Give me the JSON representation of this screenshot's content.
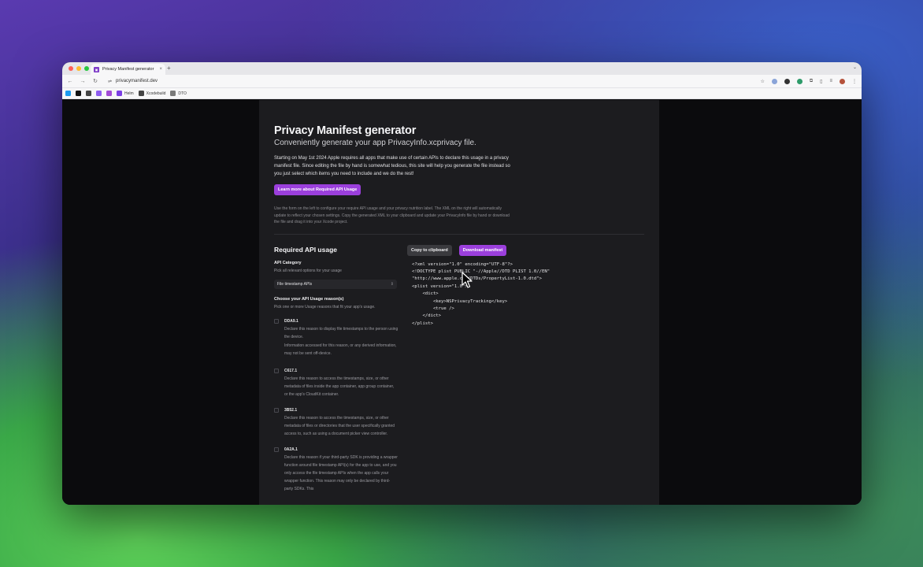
{
  "browser": {
    "tab_title": "Privacy Manifest generator",
    "tab_close": "×",
    "new_tab": "+",
    "tab_menu": "⌄",
    "url": "privacymanifest.dev",
    "bookmarks": [
      {
        "label": "",
        "color": "#1d9bf0"
      },
      {
        "label": "",
        "color": "#111111"
      },
      {
        "label": "",
        "color": "#444444"
      },
      {
        "label": "",
        "color": "#8e5cf0"
      },
      {
        "label": "",
        "color": "#a24bd6"
      },
      {
        "label": "Helm",
        "color": "#7b3fe4"
      },
      {
        "label": "Xcodebuild",
        "color": "#444444"
      },
      {
        "label": "DTO",
        "color": "#7a7a7a"
      }
    ]
  },
  "page": {
    "title": "Privacy Manifest generator",
    "subtitle": "Conveniently generate your app PrivacyInfo.xcprivacy file.",
    "intro": "Starting on May 1st 2024 Apple requires all apps that make use of certain APIs to declare this usage in a privacy manifest file. Since editing the file by hand is somewhat tedious, this site will help you generate the file instead so you just select which items you need to include and we do the rest!",
    "learn_more_button": "Learn more about Required API Usage",
    "howto": "Use the form on the left to configure your require API usage and your privacy nutrition label. The XML on the right will automatically update to reflect your chosen settings. Copy the generated XML to your clipboard and update your PrivacyInfo file by hand or download the file and drag it into your Xcode project.",
    "section_title": "Required API usage",
    "api_category_label": "API Category",
    "api_category_help": "Pick all relevant options for your usage",
    "api_category_value": "File timestamp APIs",
    "reasons_label": "Choose your API Usage reason(s)",
    "reasons_help": "Pick one or more Usage reasons that fit your app's usage.",
    "reasons": [
      {
        "code": "DDA9.1",
        "desc": "Declare this reason to display file timestamps to the person using the device.",
        "note": "Information accessed for this reason, or any derived information, may not be sent off-device."
      },
      {
        "code": "C617.1",
        "desc": "Declare this reason to access the timestamps, size, or other metadata of files inside the app container, app group container, or the app's CloudKit container.",
        "note": ""
      },
      {
        "code": "3B52.1",
        "desc": "Declare this reason to access the timestamps, size, or other metadata of files or directories that the user specifically granted access to, such as using a document picker view controller.",
        "note": ""
      },
      {
        "code": "0A2A.1",
        "desc": "Declare this reason if your third-party SDK is providing a wrapper function around file timestamp API(s) for the app to use, and you only access the file timestamp APIs when the app calls your wrapper function. This reason may only be declared by third-party SDKs. This",
        "note": ""
      }
    ],
    "copy_button": "Copy to clipboard",
    "download_button": "Download manifest",
    "xml": "<?xml version=\"1.0\" encoding=\"UTF-8\"?>\n<!DOCTYPE plist PUBLIC \"-//Apple//DTD PLIST 1.0//EN\"\n\"http://www.apple.com/DTDs/PropertyList-1.0.dtd\">\n<plist version=\"1.0\">\n    <dict>\n        <key>NSPrivacyTracking</key>\n        <true />\n    </dict>\n</plist>"
  },
  "colors": {
    "accent": "#9b3fdc",
    "panel": "#1c1c1f",
    "page_bg": "#0b0b0d"
  }
}
